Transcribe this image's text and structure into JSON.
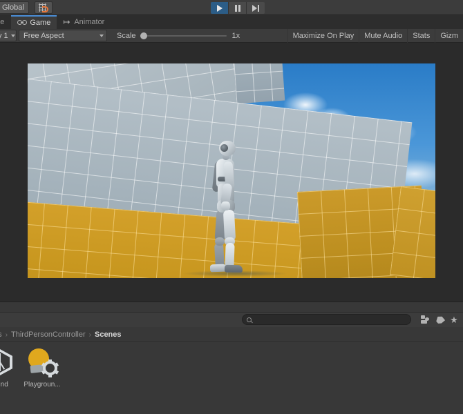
{
  "toolbar": {
    "global_button": "Global",
    "grid_snap_icon": "grid-snap-icon",
    "play_icon": "play-icon",
    "pause_icon": "pause-icon",
    "step_icon": "step-icon",
    "play_active": true,
    "accent_play_color": "#2c5d87"
  },
  "tabs": [
    {
      "label": "ene",
      "icon": "scene-icon",
      "active": false
    },
    {
      "label": "Game",
      "icon": "game-controller-icon",
      "active": true
    },
    {
      "label": "Animator",
      "icon": "animator-icon",
      "active": false
    }
  ],
  "gameview_toolbar": {
    "display_dropdown": "y 1",
    "aspect_dropdown": "Free Aspect",
    "scale_label": "Scale",
    "scale_value": "1x",
    "scale_slider_position": 0,
    "maximize_on_play": "Maximize On Play",
    "mute_audio": "Mute Audio",
    "stats": "Stats",
    "gizmos": "Gizm"
  },
  "gameview": {
    "scene_description": "3D playground scene with orange and grey grid-textured platforms, blue sky with clouds, and a humanoid robot character standing on a cyan ground plane",
    "sky_color": "#4a90d9",
    "ground_color": "#8ad2ef",
    "platform_orange": "#c8971f",
    "platform_grey": "#a8b5bd",
    "character": "robot-kyle"
  },
  "project_browser": {
    "search_placeholder": "",
    "search_value": "",
    "search_icon": "search-icon",
    "filter_icon": "filter-by-type-icon",
    "label_icon": "label-filter-icon",
    "favorites_icon": "star-icon",
    "breadcrumb": [
      {
        "label": "ets",
        "current": false
      },
      {
        "label": "ThirdPersonController",
        "current": false
      },
      {
        "label": "Scenes",
        "current": true
      }
    ],
    "breadcrumb_separator": "›",
    "assets": [
      {
        "label": "round",
        "icon": "unity-scene-icon"
      },
      {
        "label": "Playgroun...",
        "icon": "prefab-playground-icon"
      }
    ]
  }
}
